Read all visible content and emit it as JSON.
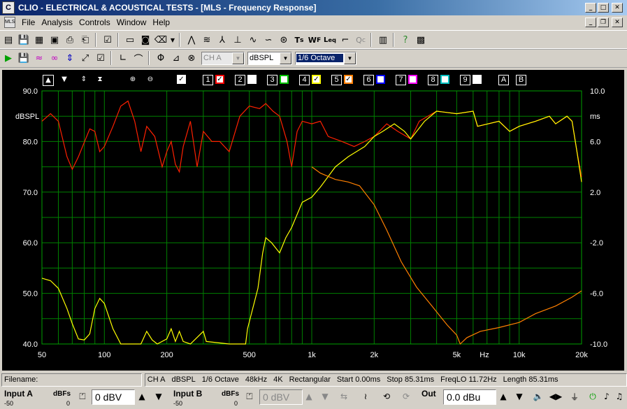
{
  "window": {
    "app_icon_text": "C",
    "title": "CLIO - ELECTRICAL & ACOUSTICAL TESTS - [MLS - Frequency Response]"
  },
  "menu": [
    "File",
    "Analysis",
    "Controls",
    "Window",
    "Help"
  ],
  "toolbar2": {
    "channel_value": "CH A",
    "unit_value": "dBSPL",
    "smoothing_value": "1/6 Octave"
  },
  "plot": {
    "header": {
      "channels": [
        "1",
        "2",
        "3",
        "4",
        "5",
        "6",
        "7",
        "8",
        "9"
      ],
      "channel_colors": [
        "#ff0000",
        "#ffffff",
        "#00c000",
        "#ffff00",
        "#ff8000",
        "#0000ff",
        "#ff00ff",
        "#00c0c0",
        "#ffffff"
      ],
      "channel_checked": [
        true,
        false,
        false,
        true,
        true,
        false,
        false,
        false,
        false
      ],
      "markers": [
        "A",
        "B"
      ]
    }
  },
  "chart_data": {
    "type": "line",
    "xscale": "log",
    "xlim": [
      50,
      20000
    ],
    "ylim": [
      40,
      90
    ],
    "y2lim": [
      -10,
      10
    ],
    "ylabel": "dBSPL",
    "y2label": "ms",
    "xunit": "Hz",
    "xticks": [
      50,
      100,
      200,
      500,
      1000,
      2000,
      5000,
      10000,
      20000
    ],
    "xtick_labels": [
      "50",
      "100",
      "200",
      "500",
      "1k",
      "2k",
      "5k",
      "10k",
      "20k"
    ],
    "yticks": [
      40,
      50,
      60,
      70,
      80,
      90
    ],
    "ytick_labels": [
      "40.0",
      "50.0",
      "60.0",
      "70.0",
      "80.0",
      "90.0"
    ],
    "y2ticks": [
      -10,
      -6,
      -2,
      2,
      6,
      10
    ],
    "y2tick_labels": [
      "-10.0",
      "-6.0",
      "-2.0",
      "2.0",
      "6.0",
      "10.0"
    ],
    "grid": true,
    "series": [
      {
        "color": "#ff2000",
        "axis": "left",
        "points": [
          [
            50,
            84
          ],
          [
            55,
            85.5
          ],
          [
            60,
            84
          ],
          [
            66,
            77
          ],
          [
            70,
            74.5
          ],
          [
            75,
            77
          ],
          [
            85,
            82.5
          ],
          [
            90,
            82
          ],
          [
            95,
            78
          ],
          [
            100,
            79
          ],
          [
            110,
            83
          ],
          [
            120,
            87
          ],
          [
            130,
            88
          ],
          [
            140,
            84
          ],
          [
            150,
            78
          ],
          [
            160,
            83
          ],
          [
            175,
            81
          ],
          [
            190,
            75
          ],
          [
            200,
            78
          ],
          [
            210,
            80
          ],
          [
            220,
            75.5
          ],
          [
            230,
            74
          ],
          [
            240,
            79
          ],
          [
            260,
            84
          ],
          [
            280,
            75
          ],
          [
            300,
            82
          ],
          [
            330,
            80
          ],
          [
            360,
            80
          ],
          [
            400,
            78
          ],
          [
            450,
            85
          ],
          [
            500,
            87
          ],
          [
            560,
            86.5
          ],
          [
            600,
            87.5
          ],
          [
            650,
            86
          ],
          [
            700,
            85
          ],
          [
            760,
            80
          ],
          [
            800,
            75
          ],
          [
            850,
            82
          ],
          [
            900,
            84
          ],
          [
            1000,
            83.5
          ],
          [
            1100,
            84
          ],
          [
            1200,
            81
          ],
          [
            1400,
            80
          ],
          [
            1600,
            79
          ],
          [
            1800,
            80
          ],
          [
            2000,
            81
          ],
          [
            2300,
            83.5
          ],
          [
            2600,
            82
          ],
          [
            3000,
            80.5
          ],
          [
            3300,
            84
          ],
          [
            4000,
            86
          ],
          [
            5000,
            85.5
          ],
          [
            6000,
            86
          ],
          [
            6300,
            83
          ],
          [
            8000,
            84
          ],
          [
            9000,
            82
          ],
          [
            10000,
            83
          ],
          [
            12000,
            84
          ],
          [
            14000,
            85
          ],
          [
            15000,
            83.5
          ],
          [
            17000,
            85
          ],
          [
            18000,
            84
          ],
          [
            19000,
            78
          ],
          [
            20000,
            73
          ]
        ]
      },
      {
        "color": "#ffff00",
        "axis": "left",
        "points": [
          [
            50,
            53
          ],
          [
            55,
            52.5
          ],
          [
            60,
            51
          ],
          [
            66,
            47
          ],
          [
            70,
            44
          ],
          [
            75,
            41
          ],
          [
            80,
            40.8
          ],
          [
            85,
            42
          ],
          [
            90,
            47
          ],
          [
            95,
            49
          ],
          [
            100,
            48
          ],
          [
            110,
            43
          ],
          [
            120,
            40
          ],
          [
            150,
            40
          ],
          [
            160,
            42.5
          ],
          [
            170,
            40.8
          ],
          [
            180,
            40
          ],
          [
            200,
            41
          ],
          [
            210,
            43
          ],
          [
            220,
            40.5
          ],
          [
            230,
            42.5
          ],
          [
            240,
            40.5
          ],
          [
            260,
            40
          ],
          [
            300,
            42.5
          ],
          [
            310,
            40.5
          ],
          [
            400,
            40
          ],
          [
            480,
            40
          ],
          [
            490,
            43
          ],
          [
            550,
            51
          ],
          [
            580,
            58
          ],
          [
            600,
            61
          ],
          [
            640,
            60
          ],
          [
            700,
            58
          ],
          [
            750,
            61
          ],
          [
            800,
            63
          ],
          [
            900,
            68
          ],
          [
            1000,
            69
          ],
          [
            1100,
            71
          ],
          [
            1300,
            75
          ],
          [
            1500,
            77
          ],
          [
            1800,
            79
          ],
          [
            2000,
            81
          ],
          [
            2200,
            82
          ],
          [
            2500,
            83.5
          ],
          [
            2800,
            82
          ],
          [
            3000,
            80.5
          ],
          [
            3500,
            84
          ],
          [
            4000,
            86
          ],
          [
            5000,
            85.5
          ],
          [
            6000,
            86
          ],
          [
            6300,
            83
          ],
          [
            8000,
            84
          ],
          [
            9000,
            82
          ],
          [
            10000,
            83
          ],
          [
            12000,
            84
          ],
          [
            14000,
            85
          ],
          [
            15000,
            83.5
          ],
          [
            17000,
            85
          ],
          [
            18000,
            84
          ],
          [
            19000,
            78
          ],
          [
            20000,
            72
          ]
        ]
      },
      {
        "color": "#ff8000",
        "axis": "right",
        "points": [
          [
            1000,
            4
          ],
          [
            1100,
            3.5
          ],
          [
            1300,
            3
          ],
          [
            1500,
            2.8
          ],
          [
            1700,
            2.5
          ],
          [
            2000,
            1
          ],
          [
            2300,
            -1
          ],
          [
            2700,
            -3.5
          ],
          [
            3200,
            -5.5
          ],
          [
            3800,
            -7
          ],
          [
            4500,
            -8.5
          ],
          [
            5000,
            -9.3
          ],
          [
            5200,
            -10
          ],
          [
            5600,
            -9.5
          ],
          [
            6500,
            -9
          ],
          [
            8000,
            -8.7
          ],
          [
            10000,
            -8.3
          ],
          [
            12000,
            -7.6
          ],
          [
            15000,
            -7
          ],
          [
            18000,
            -6.3
          ],
          [
            20000,
            -5.8
          ]
        ]
      }
    ]
  },
  "status": {
    "filename_label": "Filename:",
    "channel": "CH A",
    "unit": "dBSPL",
    "smoothing": "1/6 Octave",
    "rate": "48kHz",
    "size": "4K",
    "window": "Rectangular",
    "start": "Start 0.00ms",
    "stop": "Stop 85.31ms",
    "freqlo": "FreqLO 11.72Hz",
    "length": "Length 85.31ms"
  },
  "bottom": {
    "input_a_label": "Input A",
    "input_a_scale": "-50",
    "input_a_zero": "0",
    "input_a_unit": "dBFs",
    "input_a_value": "0 dBV",
    "input_b_label": "Input B",
    "input_b_scale": "-50",
    "input_b_zero": "0",
    "input_b_unit": "dBFs",
    "input_b_value": "0 dBV",
    "out_label": "Out",
    "out_value": "0.0 dBu"
  }
}
